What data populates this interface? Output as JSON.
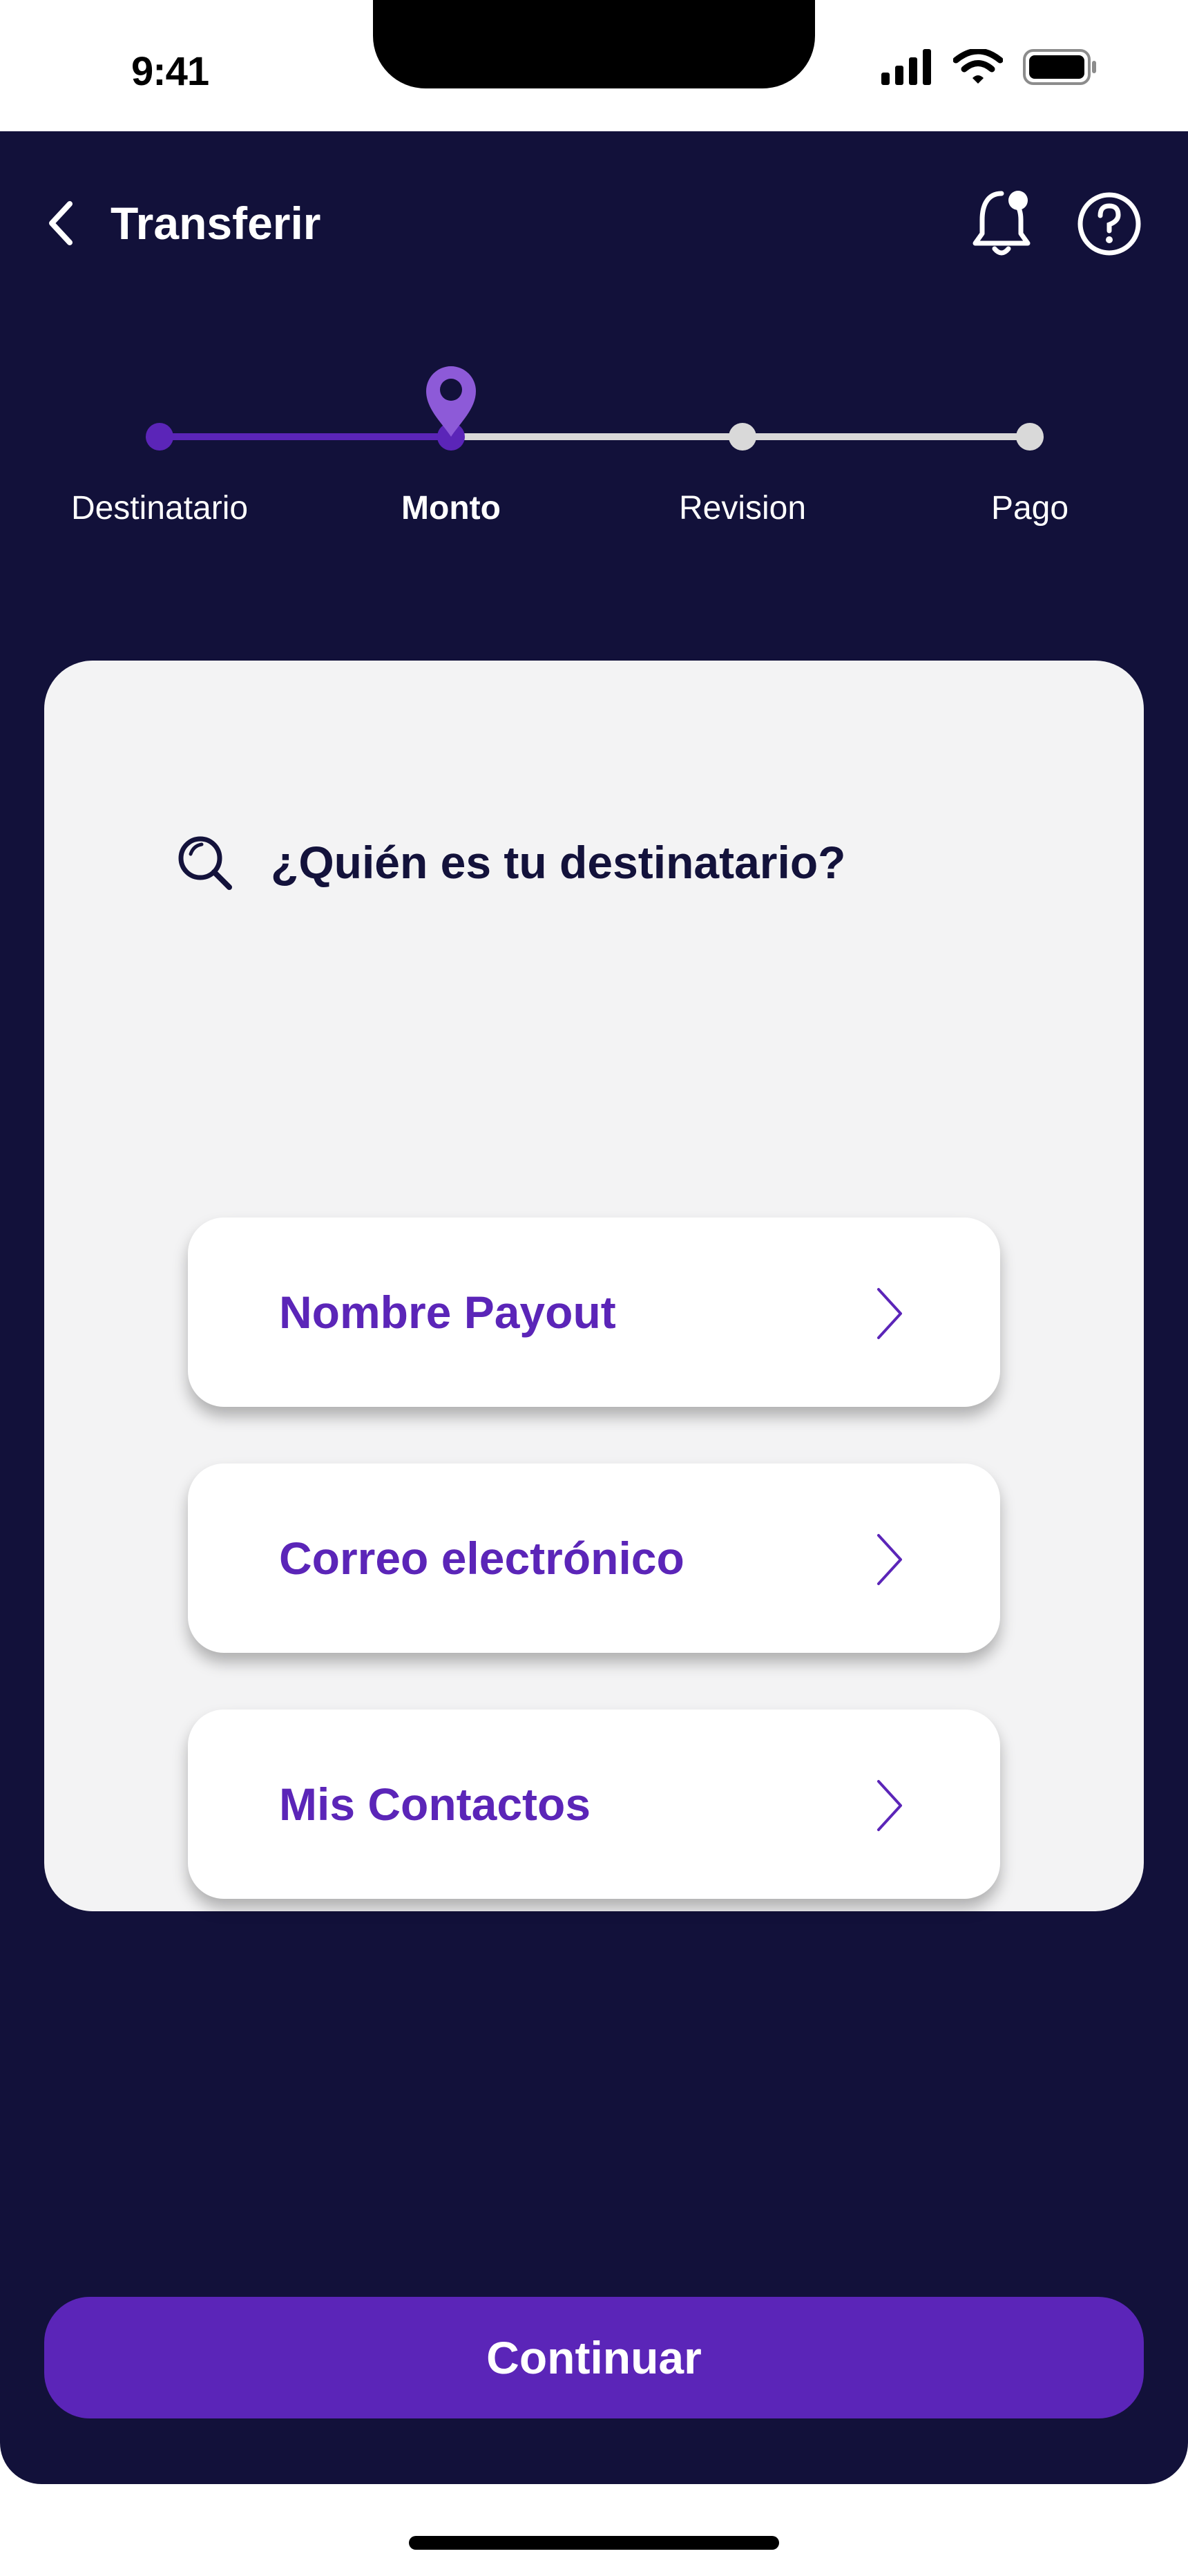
{
  "status_bar": {
    "time": "9:41"
  },
  "header": {
    "title": "Transferir"
  },
  "stepper": {
    "steps": [
      {
        "label": "Destinatario",
        "state": "done"
      },
      {
        "label": "Monto",
        "state": "current"
      },
      {
        "label": "Revision",
        "state": "pending"
      },
      {
        "label": "Pago",
        "state": "pending"
      }
    ]
  },
  "card": {
    "question": "¿Quién es tu destinatario?",
    "options": [
      {
        "label": "Nombre Payout"
      },
      {
        "label": "Correo electrónico"
      },
      {
        "label": "Mis Contactos"
      }
    ]
  },
  "footer": {
    "continue_label": "Continuar"
  },
  "colors": {
    "background": "#12113a",
    "accent": "#5b25b8",
    "accent_light": "#8d5ad8",
    "card": "#f3f3f4",
    "pending": "#d9d9d9"
  },
  "icons": [
    "back-arrow-icon",
    "bell-icon",
    "help-icon",
    "map-pin-icon",
    "search-icon",
    "chevron-right-icon"
  ]
}
